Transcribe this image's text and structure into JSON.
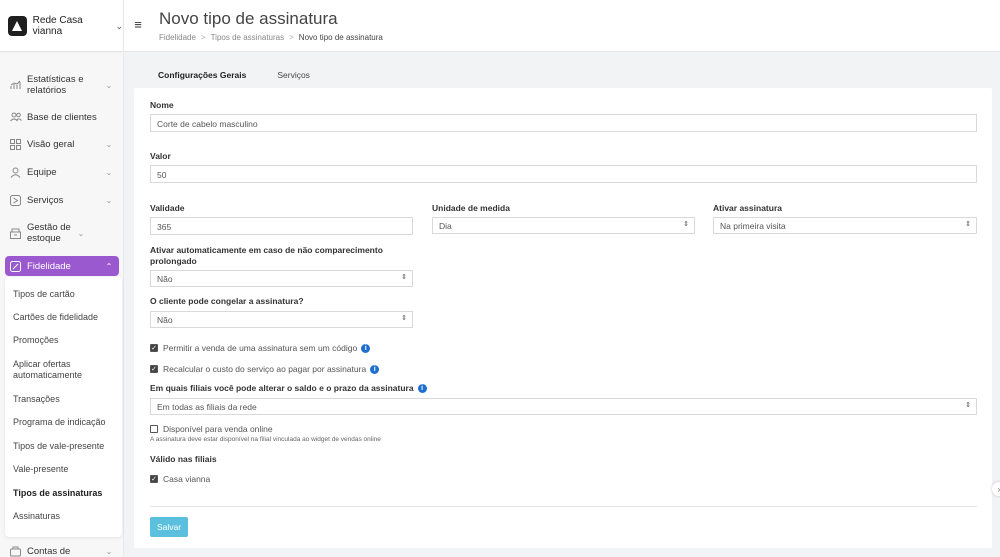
{
  "header": {
    "brand": "Rede Casa vianna",
    "title": "Novo tipo de assinatura",
    "breadcrumb": [
      "Fidelidade",
      "Tipos de assinaturas",
      "Novo tipo de assinatura"
    ]
  },
  "sidebar": {
    "items": [
      {
        "label": "Estatísticas e relatórios",
        "icon": "chart-icon"
      },
      {
        "label": "Base de clientes",
        "icon": "users-icon"
      },
      {
        "label": "Visão geral",
        "icon": "grid-icon"
      },
      {
        "label": "Equipe",
        "icon": "user-icon"
      },
      {
        "label": "Serviços",
        "icon": "services-icon"
      },
      {
        "label": "Gestão de estoque",
        "icon": "box-icon"
      },
      {
        "label": "Fidelidade",
        "icon": "loyalty-icon"
      },
      {
        "label": "Contas de",
        "icon": "accounts-icon"
      }
    ],
    "submenu": [
      "Tipos de cartão",
      "Cartões de fidelidade",
      "Promoções",
      "Aplicar ofertas automaticamente",
      "Transações",
      "Programa de indicação",
      "Tipos de vale-presente",
      "Vale-presente",
      "Tipos de assinaturas",
      "Assinaturas"
    ],
    "active_color": "#9b59d0"
  },
  "tabs": [
    "Configurações Gerais",
    "Serviços"
  ],
  "form": {
    "name_label": "Nome",
    "name_value": "Corte de cabelo masculino",
    "value_label": "Valor",
    "value_value": "50",
    "validity_label": "Validade",
    "validity_value": "365",
    "unit_label": "Unidade de medida",
    "unit_value": "Dia",
    "activate_label": "Ativar assinatura",
    "activate_value": "Na primeira visita",
    "auto_label": "Ativar automaticamente em caso de não comparecimento prolongado",
    "auto_value": "Não",
    "freeze_label": "O cliente pode congelar a assinatura?",
    "freeze_value": "Não",
    "check_sell_no_code": "Permitir a venda de uma assinatura sem um código",
    "check_recalc": "Recalcular o custo do serviço ao pagar por assinatura",
    "branches_edit_label": "Em quais filiais você pode alterar o saldo e o prazo da assinatura",
    "branches_edit_value": "Em todas as filiais da rede",
    "online_label": "Disponível para venda online",
    "online_hint": "A assinatura deve estar disponível na filial vinculada ao widget de vendas online",
    "valid_branches_label": "Válido nas filiais",
    "branch_name": "Casa vianna",
    "save": "Salvar"
  },
  "colors": {
    "save": "#5bc0de",
    "info": "#1f6fd1"
  }
}
